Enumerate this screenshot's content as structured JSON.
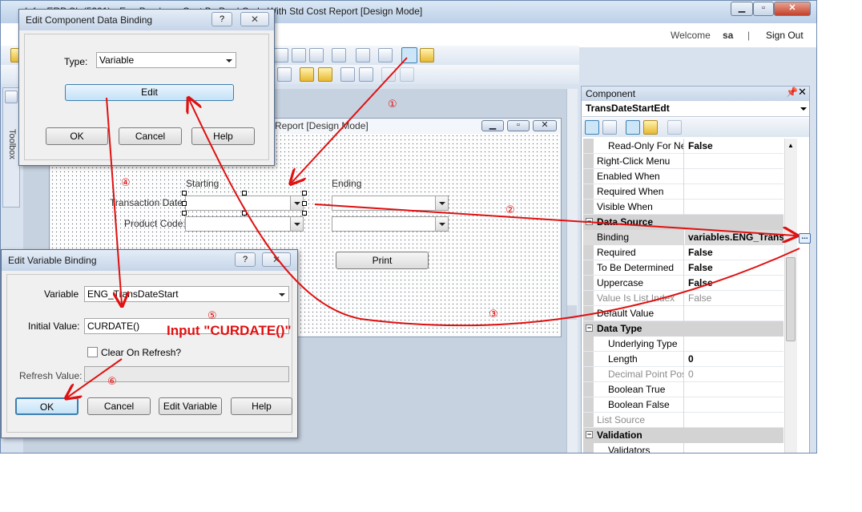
{
  "app": {
    "title": "Infor ERP SL (5201) - Eng Purchase Cost By Prod Code With Std Cost Report  [Design Mode]",
    "welcome": "Welcome",
    "user": "sa",
    "separator": "|",
    "sign_out": "Sign Out",
    "toolbox_label": "Toolbox"
  },
  "form": {
    "title": "Report  [Design Mode]",
    "starting_label": "Starting",
    "ending_label": "Ending",
    "transaction_date_label": "Transaction Date:",
    "product_code_label": "Product Code:",
    "print_button": "Print"
  },
  "component_panel": {
    "title": "Component",
    "selected_component": "TransDateStartEdt",
    "properties": [
      {
        "name": "Read-Only For New",
        "value": "False",
        "kind": "sub",
        "bold": true
      },
      {
        "name": "Right-Click Menu",
        "value": "",
        "kind": "item"
      },
      {
        "name": "Enabled When",
        "value": "",
        "kind": "item"
      },
      {
        "name": "Required When",
        "value": "",
        "kind": "item"
      },
      {
        "name": "Visible When",
        "value": "",
        "kind": "item"
      },
      {
        "name": "Data Source",
        "value": "",
        "kind": "cat"
      },
      {
        "name": "Binding",
        "value": "variables.ENG_TransDateStart",
        "kind": "item",
        "bold": true,
        "highlight": true
      },
      {
        "name": "Required",
        "value": "False",
        "kind": "item",
        "bold": true
      },
      {
        "name": "To Be Determined",
        "value": "False",
        "kind": "item",
        "bold": true
      },
      {
        "name": "Uppercase",
        "value": "False",
        "kind": "item",
        "bold": true
      },
      {
        "name": "Value Is List Index",
        "value": "False",
        "kind": "item",
        "disabled": true
      },
      {
        "name": "Default Value",
        "value": "",
        "kind": "item"
      },
      {
        "name": "Data Type",
        "value": "",
        "kind": "cat"
      },
      {
        "name": "Underlying Type",
        "value": "",
        "kind": "sub"
      },
      {
        "name": "Length",
        "value": "0",
        "kind": "sub",
        "bold": true
      },
      {
        "name": "Decimal Point Position",
        "value": "0",
        "kind": "sub",
        "disabled": true
      },
      {
        "name": "Boolean True",
        "value": "",
        "kind": "sub"
      },
      {
        "name": "Boolean False",
        "value": "",
        "kind": "sub"
      },
      {
        "name": "List Source",
        "value": "",
        "kind": "item",
        "disabled": true
      },
      {
        "name": "Validation",
        "value": "",
        "kind": "cat"
      },
      {
        "name": "Validators",
        "value": "",
        "kind": "sub"
      }
    ],
    "ellipsis": "..."
  },
  "dialog_binding": {
    "title": "Edit Component Data Binding",
    "help_glyph": "?",
    "close_glyph": "✕",
    "type_label": "Type:",
    "type_value": "Variable",
    "edit_button": "Edit",
    "ok_button": "OK",
    "cancel_button": "Cancel",
    "help_button": "Help"
  },
  "dialog_variable": {
    "title": "Edit Variable Binding",
    "help_glyph": "?",
    "close_glyph": "✕",
    "variable_label": "Variable",
    "variable_value": "ENG_TransDateStart",
    "initial_value_label": "Initial Value:",
    "initial_value": "CURDATE()",
    "clear_on_refresh_label": "Clear On Refresh?",
    "refresh_value_label": "Refresh Value:",
    "ok_button": "OK",
    "cancel_button": "Cancel",
    "edit_variable_button": "Edit Variable",
    "help_button": "Help"
  },
  "annotations": {
    "steps": [
      "①",
      "②",
      "③",
      "④",
      "⑤",
      "⑥"
    ],
    "input_note": "Input \"CURDATE()\"",
    "color": "#e01010"
  }
}
